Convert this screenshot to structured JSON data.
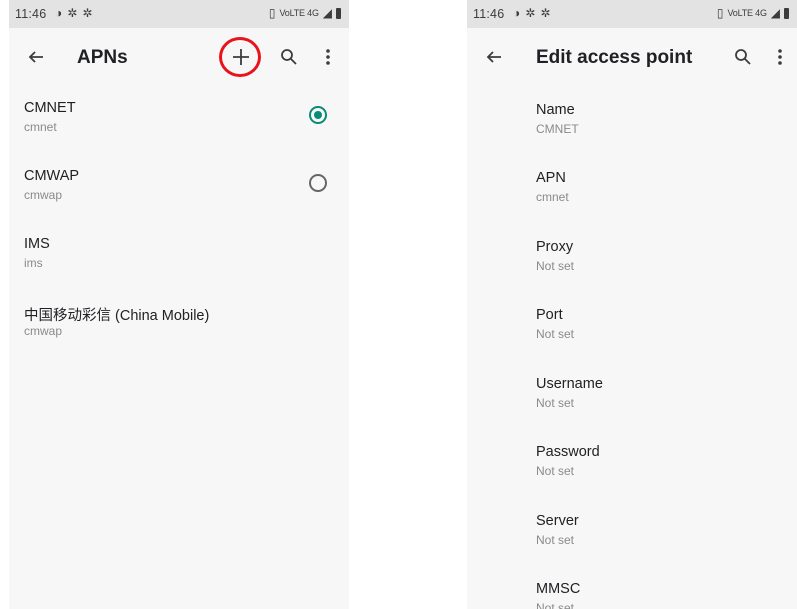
{
  "left": {
    "status": {
      "time": "11:46",
      "signal": "VoLTE 4G"
    },
    "title": "APNs",
    "items": [
      {
        "name": "CMNET",
        "sub": "cmnet",
        "radio": "selected"
      },
      {
        "name": "CMWAP",
        "sub": "cmwap",
        "radio": "unselected"
      },
      {
        "name": "IMS",
        "sub": "ims"
      },
      {
        "name": "中国移动彩信 (China Mobile)",
        "sub": "cmwap"
      }
    ]
  },
  "right": {
    "status": {
      "time": "11:46",
      "signal": "VoLTE 4G"
    },
    "title": "Edit access point",
    "fields": [
      {
        "label": "Name",
        "value": "CMNET"
      },
      {
        "label": "APN",
        "value": "cmnet"
      },
      {
        "label": "Proxy",
        "value": "Not set"
      },
      {
        "label": "Port",
        "value": "Not set"
      },
      {
        "label": "Username",
        "value": "Not set"
      },
      {
        "label": "Password",
        "value": "Not set"
      },
      {
        "label": "Server",
        "value": "Not set"
      },
      {
        "label": "MMSC",
        "value": "Not set"
      }
    ]
  },
  "colors": {
    "accent": "#0a8a78",
    "highlight": "#e8141b",
    "status_bar": "#e3e3e3",
    "background": "#f7f7f7"
  },
  "icons": {
    "back": "arrow-left-icon",
    "add": "plus-icon",
    "search": "search-icon",
    "more": "more-vert-icon"
  }
}
